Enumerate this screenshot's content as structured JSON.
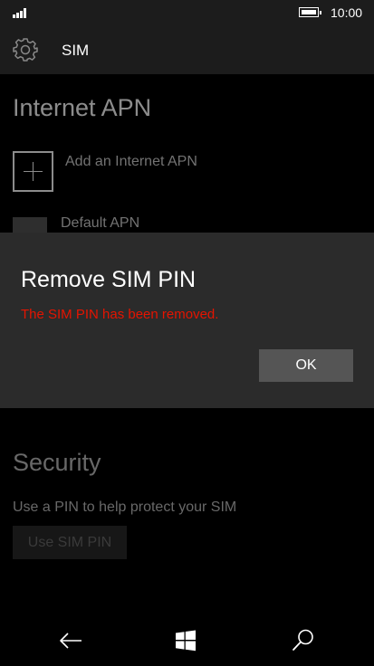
{
  "status_bar": {
    "time": "10:00",
    "signal_icon": "signal-bars-icon",
    "battery_icon": "battery-icon"
  },
  "header": {
    "title": "SIM",
    "icon": "gear-icon"
  },
  "apn": {
    "title": "Internet APN",
    "add_label": "Add an Internet APN",
    "default_label": "Default APN"
  },
  "dialog": {
    "title": "Remove SIM PIN",
    "message": "The SIM PIN has been removed.",
    "ok_label": "OK",
    "message_color": "#e51400"
  },
  "security": {
    "title": "Security",
    "description": "Use a PIN to help protect your SIM",
    "use_pin_label": "Use SIM PIN"
  },
  "nav": {
    "back_icon": "back-arrow-icon",
    "start_icon": "windows-start-icon",
    "search_icon": "search-icon"
  }
}
